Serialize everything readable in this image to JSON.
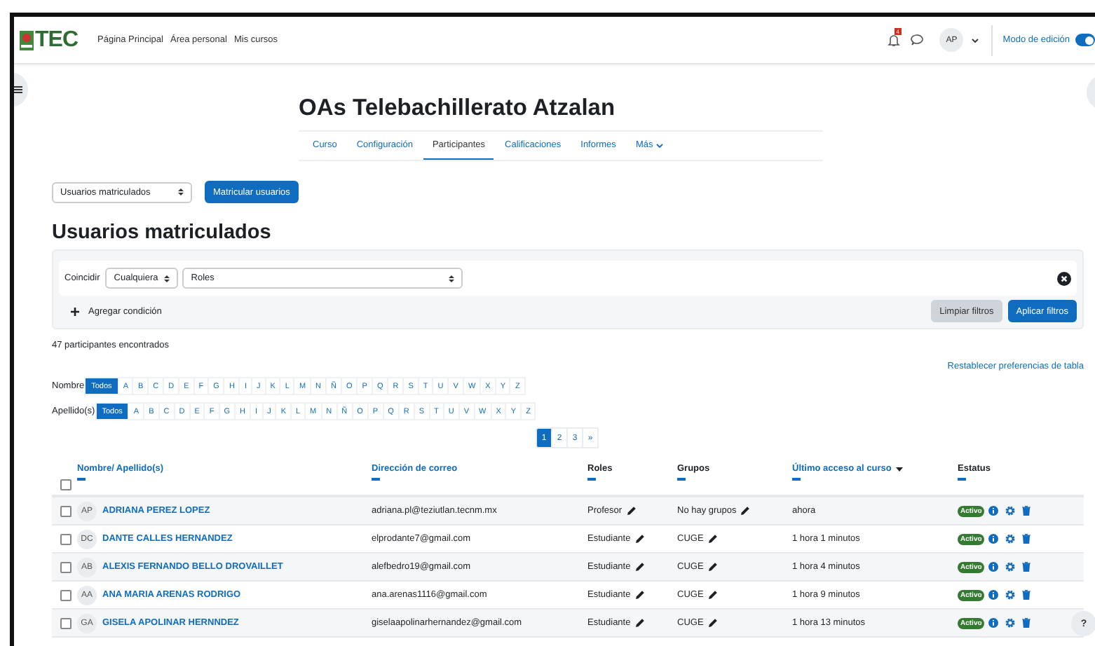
{
  "navbar": {
    "logo_text": "TEC",
    "links": [
      "Página Principal",
      "Área personal",
      "Mis cursos"
    ],
    "notification_count": "4",
    "avatar_initials": "AP",
    "edit_mode_label": "Modo de edición",
    "edit_mode_on": true
  },
  "course": {
    "title": "OAs Telebachillerato Atzalan",
    "tabs": [
      {
        "label": "Curso",
        "selected": false
      },
      {
        "label": "Configuración",
        "selected": false
      },
      {
        "label": "Participantes",
        "selected": true
      },
      {
        "label": "Calificaciones",
        "selected": false
      },
      {
        "label": "Informes",
        "selected": false
      },
      {
        "label": "Más",
        "selected": false
      }
    ]
  },
  "enrol_select": "Usuarios matriculados",
  "enrol_button": "Matricular usuarios",
  "heading": "Usuarios matriculados",
  "filter": {
    "match_label": "Coincidir",
    "match_value": "Cualquiera",
    "type_value": "Roles",
    "add_condition": "Agregar condición",
    "clear_button": "Limpiar filtros",
    "apply_button": "Aplicar filtros"
  },
  "found_text": "47 participantes encontrados",
  "reset_link": "Restablecer preferencias de tabla",
  "initials_bars": [
    {
      "label": "Nombre",
      "options": [
        {
          "label": "Todos",
          "selected": true
        },
        {
          "label": "A",
          "selected": false
        },
        {
          "label": "B",
          "selected": false
        },
        {
          "label": "C",
          "selected": false
        },
        {
          "label": "D",
          "selected": false
        },
        {
          "label": "E",
          "selected": false
        },
        {
          "label": "F",
          "selected": false
        },
        {
          "label": "G",
          "selected": false
        },
        {
          "label": "H",
          "selected": false
        },
        {
          "label": "I",
          "selected": false
        },
        {
          "label": "J",
          "selected": false
        },
        {
          "label": "K",
          "selected": false
        },
        {
          "label": "L",
          "selected": false
        },
        {
          "label": "M",
          "selected": false
        },
        {
          "label": "N",
          "selected": false
        },
        {
          "label": "Ñ",
          "selected": false
        },
        {
          "label": "O",
          "selected": false
        },
        {
          "label": "P",
          "selected": false
        },
        {
          "label": "Q",
          "selected": false
        },
        {
          "label": "R",
          "selected": false
        },
        {
          "label": "S",
          "selected": false
        },
        {
          "label": "T",
          "selected": false
        },
        {
          "label": "U",
          "selected": false
        },
        {
          "label": "V",
          "selected": false
        },
        {
          "label": "W",
          "selected": false
        },
        {
          "label": "X",
          "selected": false
        },
        {
          "label": "Y",
          "selected": false
        },
        {
          "label": "Z",
          "selected": false
        }
      ]
    },
    {
      "label": "Apellido(s)",
      "options": [
        {
          "label": "Todos",
          "selected": true
        },
        {
          "label": "A",
          "selected": false
        },
        {
          "label": "B",
          "selected": false
        },
        {
          "label": "C",
          "selected": false
        },
        {
          "label": "D",
          "selected": false
        },
        {
          "label": "E",
          "selected": false
        },
        {
          "label": "F",
          "selected": false
        },
        {
          "label": "G",
          "selected": false
        },
        {
          "label": "H",
          "selected": false
        },
        {
          "label": "I",
          "selected": false
        },
        {
          "label": "J",
          "selected": false
        },
        {
          "label": "K",
          "selected": false
        },
        {
          "label": "L",
          "selected": false
        },
        {
          "label": "M",
          "selected": false
        },
        {
          "label": "N",
          "selected": false
        },
        {
          "label": "Ñ",
          "selected": false
        },
        {
          "label": "O",
          "selected": false
        },
        {
          "label": "P",
          "selected": false
        },
        {
          "label": "Q",
          "selected": false
        },
        {
          "label": "R",
          "selected": false
        },
        {
          "label": "S",
          "selected": false
        },
        {
          "label": "T",
          "selected": false
        },
        {
          "label": "U",
          "selected": false
        },
        {
          "label": "V",
          "selected": false
        },
        {
          "label": "W",
          "selected": false
        },
        {
          "label": "X",
          "selected": false
        },
        {
          "label": "Y",
          "selected": false
        },
        {
          "label": "Z",
          "selected": false
        }
      ]
    }
  ],
  "pagination": [
    {
      "label": "1",
      "selected": true
    },
    {
      "label": "2",
      "selected": false
    },
    {
      "label": "3",
      "selected": false
    },
    {
      "label": "»",
      "selected": false
    }
  ],
  "table": {
    "select_all_checked": false,
    "columns": [
      {
        "label": "Nombre",
        "separator": "/",
        "label2": "Apellido(s)",
        "sorted": false
      },
      {
        "label": "Dirección de correo",
        "sorted": false
      },
      {
        "label": "Roles",
        "sorted": false
      },
      {
        "label": "Grupos",
        "sorted": false
      },
      {
        "label": "Último acceso al curso",
        "sorted": true
      },
      {
        "label": "Estatus",
        "sorted": false
      }
    ],
    "rows": [
      {
        "checked": false,
        "initials": "AP",
        "name": "ADRIANA PEREZ LOPEZ",
        "email": "adriana.pl@teziutlan.tecnm.mx",
        "role": "Profesor",
        "group": "No hay grupos",
        "last_access": "ahora",
        "status": "Activo"
      },
      {
        "checked": false,
        "initials": "DC",
        "name": "DANTE CALLES HERNANDEZ",
        "email": "elprodante7@gmail.com",
        "role": "Estudiante",
        "group": "CUGE",
        "last_access": "1 hora 1 minutos",
        "status": "Activo"
      },
      {
        "checked": false,
        "initials": "AB",
        "name": "ALEXIS FERNANDO BELLO DROVAILLET",
        "email": "alefbedro19@gmail.com",
        "role": "Estudiante",
        "group": "CUGE",
        "last_access": "1 hora 4 minutos",
        "status": "Activo"
      },
      {
        "checked": false,
        "initials": "AA",
        "name": "ANA MARIA ARENAS RODRIGO",
        "email": "ana.arenas1116@gmail.com",
        "role": "Estudiante",
        "group": "CUGE",
        "last_access": "1 hora 9 minutos",
        "status": "Activo"
      },
      {
        "checked": false,
        "initials": "GA",
        "name": "GISELA APOLINAR HERNNDEZ",
        "email": "giselaapolinarhernandez@gmail.com",
        "role": "Estudiante",
        "group": "CUGE",
        "last_access": "1 hora 13 minutos",
        "status": "Activo"
      }
    ]
  },
  "help_button": "?"
}
